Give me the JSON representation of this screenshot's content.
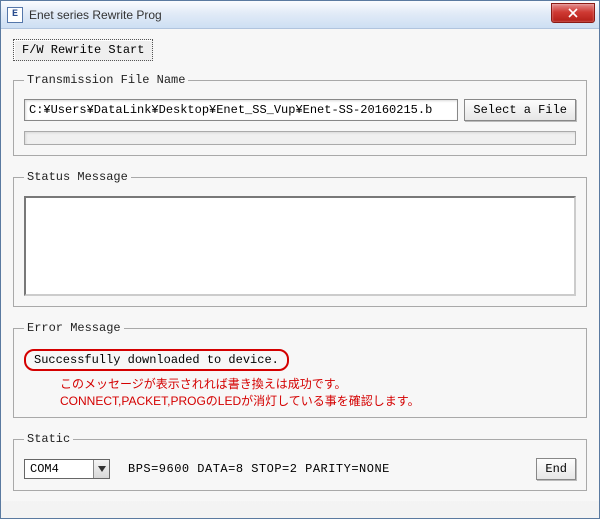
{
  "window": {
    "title": "Enet series Rewrite Prog",
    "app_icon_label": "E"
  },
  "buttons": {
    "fw_start": "F/W Rewrite Start",
    "select_file": "Select a File",
    "end": "End"
  },
  "groups": {
    "transmission": "Transmission File Name",
    "status": "Status Message",
    "error": "Error Message",
    "static": "Static"
  },
  "file": {
    "path": "C:¥Users¥DataLink¥Desktop¥Enet_SS_Vup¥Enet-SS-20160215.b"
  },
  "status": {
    "content": ""
  },
  "error": {
    "message": "Successfully downloaded to device.",
    "annotation_line1": "このメッセージが表示されれば書き換えは成功です。",
    "annotation_line2": "CONNECT,PACKET,PROGのLEDが消灯している事を確認します。"
  },
  "static": {
    "port": "COM4",
    "info": "BPS=9600  DATA=8  STOP=2  PARITY=NONE"
  }
}
